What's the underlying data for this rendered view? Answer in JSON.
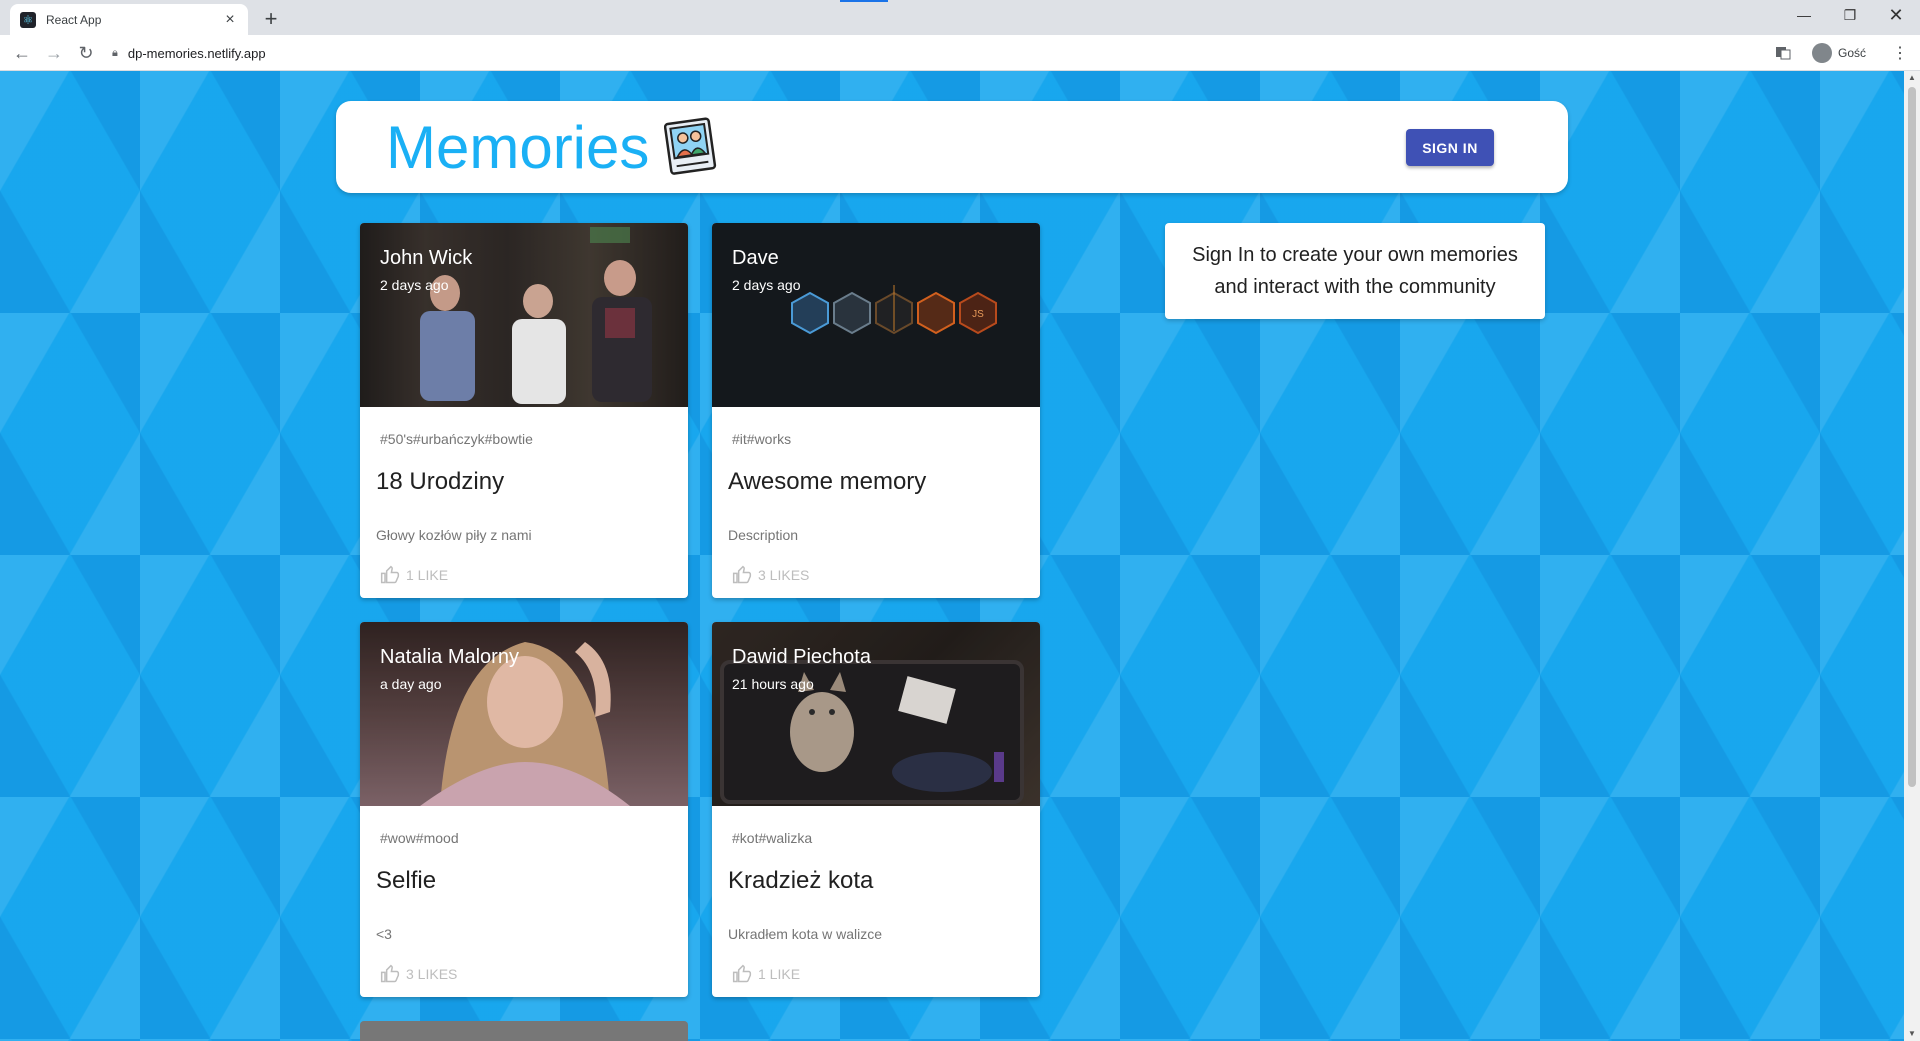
{
  "browser": {
    "tab_title": "React App",
    "url": "dp-memories.netlify.app",
    "profile_label": "Gość"
  },
  "app": {
    "brand": "Memories",
    "signin_label": "SIGN IN",
    "info_text": "Sign In to create your own memories and interact with the community"
  },
  "posts": [
    {
      "author": "John Wick",
      "time": "2 days ago",
      "tags": "#50's#urbańczyk#bowtie",
      "title": "18 Urodziny",
      "description": "Głowy kozłów piły z nami",
      "likes": "1 LIKE",
      "image": "party-photo"
    },
    {
      "author": "Dave",
      "time": "2 days ago",
      "tags": "#it#works",
      "title": "Awesome memory",
      "description": "Description",
      "likes": "3 LIKES",
      "image": "tech-hexagons"
    },
    {
      "author": "Natalia Malorny",
      "time": "a day ago",
      "tags": "#wow#mood",
      "title": "Selfie",
      "description": "<3",
      "likes": "3 LIKES",
      "image": "selfie-photo"
    },
    {
      "author": "Dawid Piechota",
      "time": "21 hours ago",
      "tags": "#kot#walizka",
      "title": "Kradzież kota",
      "description": "Ukradłem kota w walizce",
      "likes": "1 LIKE",
      "image": "cat-in-suitcase-photo"
    }
  ],
  "colors": {
    "background": "#1ab0f5",
    "brand": "#1ab0f5",
    "button": "#3f51b5"
  }
}
